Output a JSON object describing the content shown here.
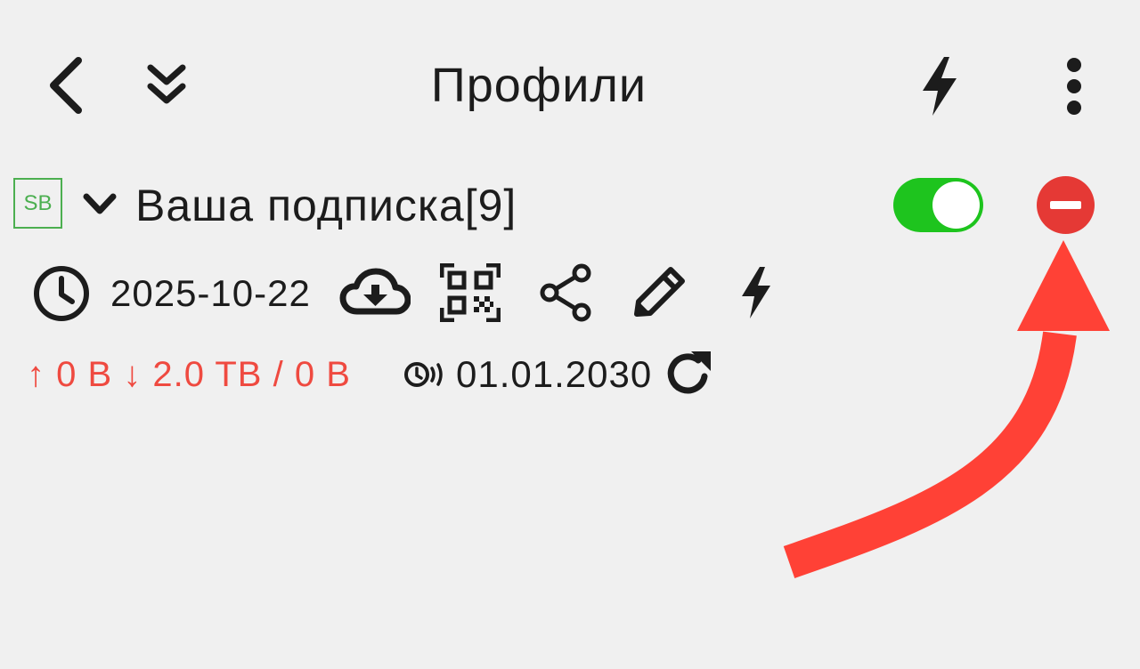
{
  "header": {
    "back_icon": "back-chevron-icon",
    "collapse_icon": "double-chevron-down-icon",
    "title": "Профили",
    "flash_icon": "lightning-icon",
    "menu_icon": "more-vertical-icon"
  },
  "subscription": {
    "badge": "SB",
    "name": "Ваша подписка[9]",
    "enabled": true,
    "updated_date": "2025-10-22",
    "actions": [
      "cloud-download-icon",
      "qr-code-icon",
      "share-icon",
      "edit-pencil-icon",
      "lightning-icon"
    ],
    "traffic": "↑ 0 B ↓ 2.0 TB / 0 B",
    "expire_date": "01.01.2030"
  },
  "colors": {
    "background": "#f0f0f0",
    "toggle_on": "#1ec41e",
    "remove": "#e53935",
    "badge": "#4caf50",
    "traffic_text": "#ef4a40",
    "annotation_arrow": "#ff4136"
  }
}
